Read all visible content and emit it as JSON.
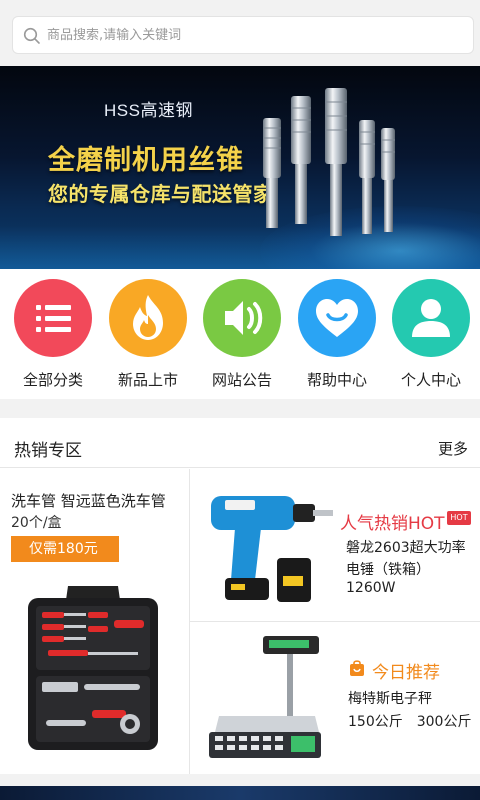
{
  "search": {
    "placeholder": "商品搜索,请输入关键词"
  },
  "banner": {
    "subtitle": "HSS高速钢",
    "title": "全磨制机用丝锥",
    "slogan": "您的专属仓库与配送管家"
  },
  "nav": {
    "items": [
      {
        "label": "全部分类",
        "icon": "list-icon",
        "color": "#f2495a"
      },
      {
        "label": "新品上市",
        "icon": "fire-icon",
        "color": "#f9a825"
      },
      {
        "label": "网站公告",
        "icon": "speaker-icon",
        "color": "#7ac943"
      },
      {
        "label": "帮助中心",
        "icon": "heart-icon",
        "color": "#2aa4f4"
      },
      {
        "label": "个人中心",
        "icon": "person-icon",
        "color": "#24c9b0"
      }
    ]
  },
  "hot": {
    "title": "热销专区",
    "more": "更多",
    "left": {
      "name": "洗车管 智远蓝色洗车管",
      "spec": "20个/盒",
      "price": "仅需180元"
    },
    "right_top": {
      "tag": "人气热销HOT",
      "badge": "HOT",
      "line1": "磐龙2603超大功率",
      "line2": "电锤（铁箱）",
      "line3": "1260W"
    },
    "right_bottom": {
      "tag": "今日推荐",
      "line1": "梅特斯电子秤",
      "line2": "150公斤　300公斤"
    }
  },
  "colors": {
    "accent_orange": "#f28a1c",
    "accent_red": "#e53a44"
  }
}
